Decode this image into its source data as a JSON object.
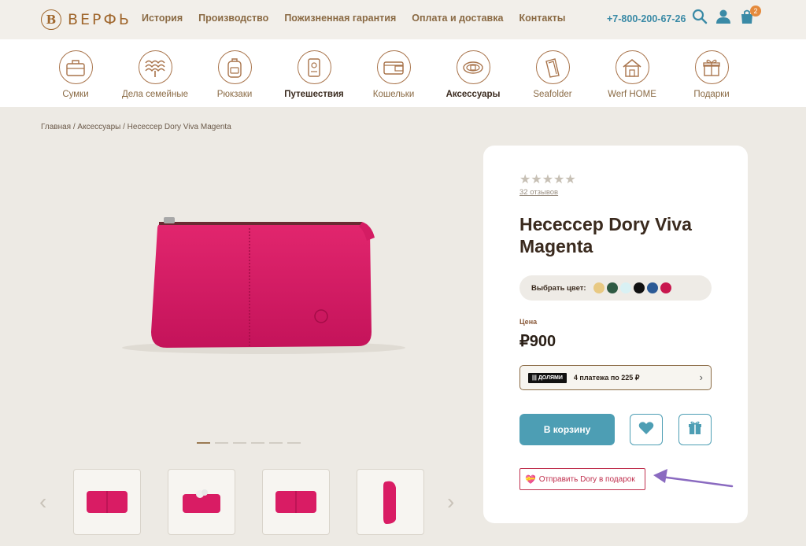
{
  "header": {
    "logo_mark": "B",
    "logo_text": "ВЕРФЬ",
    "nav": [
      "История",
      "Производство",
      "Пожизненная гарантия",
      "Оплата и доставка",
      "Контакты"
    ],
    "phone": "+7-800-200-67-26",
    "cart_count": "2"
  },
  "categories": [
    {
      "label": "Сумки",
      "icon": "bag-icon"
    },
    {
      "label": "Дела семейные",
      "icon": "family-tree-icon"
    },
    {
      "label": "Рюкзаки",
      "icon": "backpack-icon"
    },
    {
      "label": "Путешествия",
      "icon": "passport-icon"
    },
    {
      "label": "Кошельки",
      "icon": "wallet-icon"
    },
    {
      "label": "Аксессуары",
      "icon": "belt-icon"
    },
    {
      "label": "Seafolder",
      "icon": "folder-icon"
    },
    {
      "label": "Werf HOME",
      "icon": "house-icon"
    },
    {
      "label": "Подарки",
      "icon": "gift-box-icon"
    }
  ],
  "breadcrumb": {
    "home": "Главная",
    "sep": " / ",
    "section": "Аксессуары",
    "current": "Несессер Dory Viva Magenta"
  },
  "gallery": {
    "slide_count": 6,
    "active_slide": 1,
    "thumbs": 4
  },
  "product": {
    "stars": "★★★★★",
    "reviews": "32 отзывов",
    "title": "Несессер Dory Viva Magenta",
    "color_label": "Выбрать цвет:",
    "colors": [
      "#e8c983",
      "#2f5a43",
      "#d9f1f4",
      "#111111",
      "#2c5a96",
      "#c8174e"
    ],
    "price_label": "Цена",
    "price": "₽900",
    "dolyami_logo": "||| ДОЛЯМИ",
    "dolyami_text": "4 платежа по 225 ₽",
    "cart_button": "В корзину",
    "gift_link": "Отправить Dory в подарок"
  },
  "colors": {
    "accent": "#4d9eb4",
    "brand": "#a0672d",
    "product": "#d91c64",
    "gift": "#c0304e",
    "annotation_arrow": "#8a6ac0"
  }
}
